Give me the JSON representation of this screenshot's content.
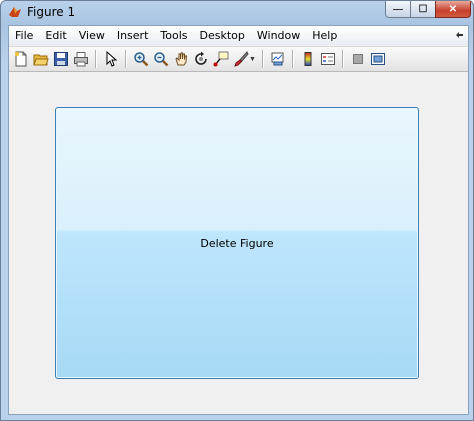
{
  "window": {
    "title": "Figure 1",
    "min_glyph": "—",
    "max_glyph": "☐",
    "close_glyph": "✕"
  },
  "menubar": {
    "items": [
      "File",
      "Edit",
      "View",
      "Insert",
      "Tools",
      "Desktop",
      "Window",
      "Help"
    ]
  },
  "toolbar": {
    "icons": [
      "new-figure-icon",
      "open-file-icon",
      "save-figure-icon",
      "print-figure-icon",
      "edit-plot-icon",
      "zoom-in-icon",
      "zoom-out-icon",
      "pan-icon",
      "rotate-3d-icon",
      "data-cursor-icon",
      "brush-icon",
      "link-plot-icon",
      "insert-colorbar-icon",
      "insert-legend-icon",
      "hide-plot-tools-icon",
      "show-plot-tools-icon"
    ]
  },
  "main": {
    "button_label": "Delete Figure"
  },
  "colors": {
    "button_border": "#3c7fb1",
    "client_bg": "#f0f0f0"
  }
}
